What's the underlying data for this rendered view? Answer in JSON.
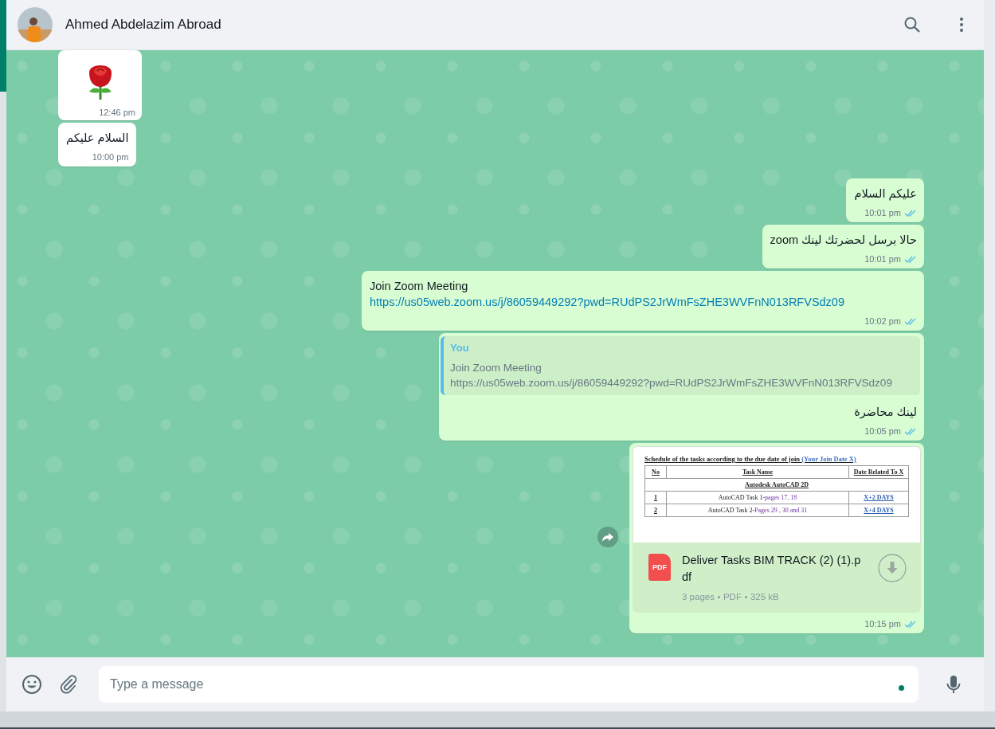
{
  "header": {
    "contact_name": "Ahmed Abdelazim Abroad"
  },
  "messages": [
    {
      "kind": "sticker",
      "outgoing": false,
      "time": "12:46 pm"
    },
    {
      "kind": "text",
      "outgoing": false,
      "text": "السلام عليكم",
      "time": "10:00 pm"
    },
    {
      "kind": "text",
      "outgoing": true,
      "text": "عليكم السلام",
      "time": "10:01 pm",
      "read": true
    },
    {
      "kind": "text",
      "outgoing": true,
      "text": "حالا برسل لحضرتك لينك zoom",
      "time": "10:01 pm",
      "read": true
    },
    {
      "kind": "link",
      "outgoing": true,
      "text": "Join Zoom Meeting",
      "link": "https://us05web.zoom.us/j/86059449292?pwd=RUdPS2JrWmFsZHE3WVFnN013RFVSdz09",
      "time": "10:02 pm",
      "read": true
    },
    {
      "kind": "reply",
      "outgoing": true,
      "quote_author": "You",
      "quote_lines": [
        "Join Zoom Meeting",
        "https://us05web.zoom.us/j/86059449292?pwd=RUdPS2JrWmFsZHE3WVFnN013RFVSdz09"
      ],
      "text": "لينك محاضرة",
      "time": "10:05 pm",
      "read": true
    },
    {
      "kind": "document",
      "outgoing": true,
      "preview": {
        "title": "Schedule of the tasks according to the due date of join",
        "title_link": "(Your Join Date   X)",
        "columns": [
          "No",
          "Task Name",
          "Date Related To X"
        ],
        "section": "Autodesk AutoCAD 2D",
        "rows": [
          {
            "no": "1",
            "task": "AutoCAD Task 1-",
            "pages": "pages 17, 18",
            "date": "X+2 DAYS"
          },
          {
            "no": "2",
            "task": "AutoCAD Task 2-",
            "pages": "Pages 29 , 30 and 31",
            "date": "X+4 DAYS"
          }
        ]
      },
      "file_name": "Deliver Tasks BIM TRACK (2) (1).pdf",
      "file_badge": "PDF",
      "file_meta": [
        "3 pages",
        "PDF",
        "325 kB"
      ],
      "time": "10:15 pm",
      "read": true
    }
  ],
  "composer": {
    "placeholder": "Type a message"
  }
}
